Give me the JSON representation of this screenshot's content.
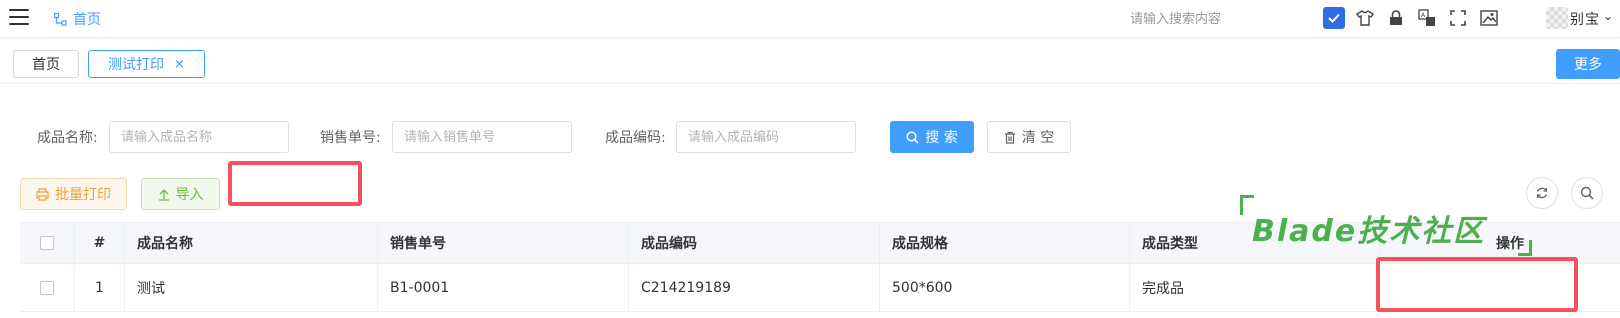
{
  "header": {
    "breadcrumb_home": "首页",
    "search_placeholder": "请输入搜索内容",
    "toolbar_icons": [
      "checkbox-icon",
      "shirt-icon",
      "lock-icon",
      "translate-icon",
      "fullscreen-icon",
      "image-icon"
    ],
    "username": "别宝",
    "accent_color": "#409eff"
  },
  "tags": {
    "items": [
      {
        "label": "首页",
        "active": false
      },
      {
        "label": "测试打印",
        "active": true,
        "close": "×"
      }
    ],
    "more_label": "更多"
  },
  "search_form": {
    "fields": [
      {
        "label": "成品名称:",
        "placeholder": "请输入成品名称",
        "value": ""
      },
      {
        "label": "销售单号:",
        "placeholder": "请输入销售单号",
        "value": ""
      },
      {
        "label": "成品编码:",
        "placeholder": "请输入成品编码",
        "value": ""
      }
    ],
    "search_label": "搜 索",
    "clear_label": "清 空"
  },
  "actions": {
    "batch_print_label": "批量打印",
    "import_label": "导入",
    "refresh_icon": "refresh-icon",
    "search_toggle_icon": "search-icon"
  },
  "table": {
    "columns": [
      "",
      "#",
      "成品名称",
      "销售单号",
      "成品编码",
      "成品规格",
      "成品类型",
      "操作"
    ],
    "rows": [
      {
        "index": "1",
        "name": "测试",
        "order_no": "B1-0001",
        "code": "C214219189",
        "spec": "500*600",
        "type": "完成品"
      }
    ]
  },
  "watermark": {
    "text": "Blade技术社区",
    "color": "#4caf50"
  },
  "annotation_color": "#f5515f"
}
